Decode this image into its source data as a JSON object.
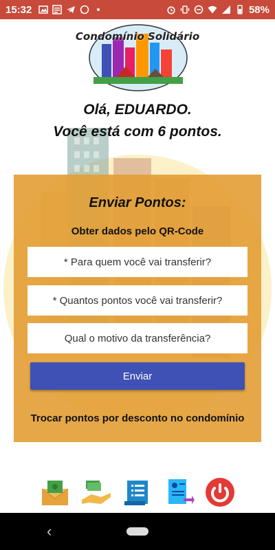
{
  "status_bar": {
    "time": "15:32",
    "battery": "58%",
    "left_icons": [
      "image-icon",
      "news-icon",
      "telegram-icon",
      "whatsapp-icon",
      "dot-icon"
    ],
    "right_icons": [
      "alarm-icon",
      "vibrate-icon",
      "dnd-icon",
      "wifi-icon",
      "signal-icon",
      "battery-icon"
    ]
  },
  "logo": {
    "title": "Condomínio Solidário"
  },
  "greeting": {
    "line1": "Olá, EDUARDO.",
    "line2": "Você está com 6 pontos."
  },
  "card": {
    "title": "Enviar Pontos:",
    "qr_link": "Obter dados pelo QR-Code",
    "recipient_placeholder": "* Para quem você vai transferir?",
    "points_placeholder": "* Quantos pontos você vai transferir?",
    "reason_placeholder": "Qual o motivo da transferência?",
    "send_label": "Enviar",
    "trade_link": "Trocar pontos por desconto no condomínio"
  },
  "toolbar": {
    "items": [
      "money-envelope-icon",
      "money-hand-icon",
      "list-document-icon",
      "profile-document-icon",
      "power-icon"
    ]
  },
  "colors": {
    "status_bar": "#c84a3a",
    "card": "#e3a037",
    "button": "#3f51b5",
    "power": "#e53935"
  }
}
